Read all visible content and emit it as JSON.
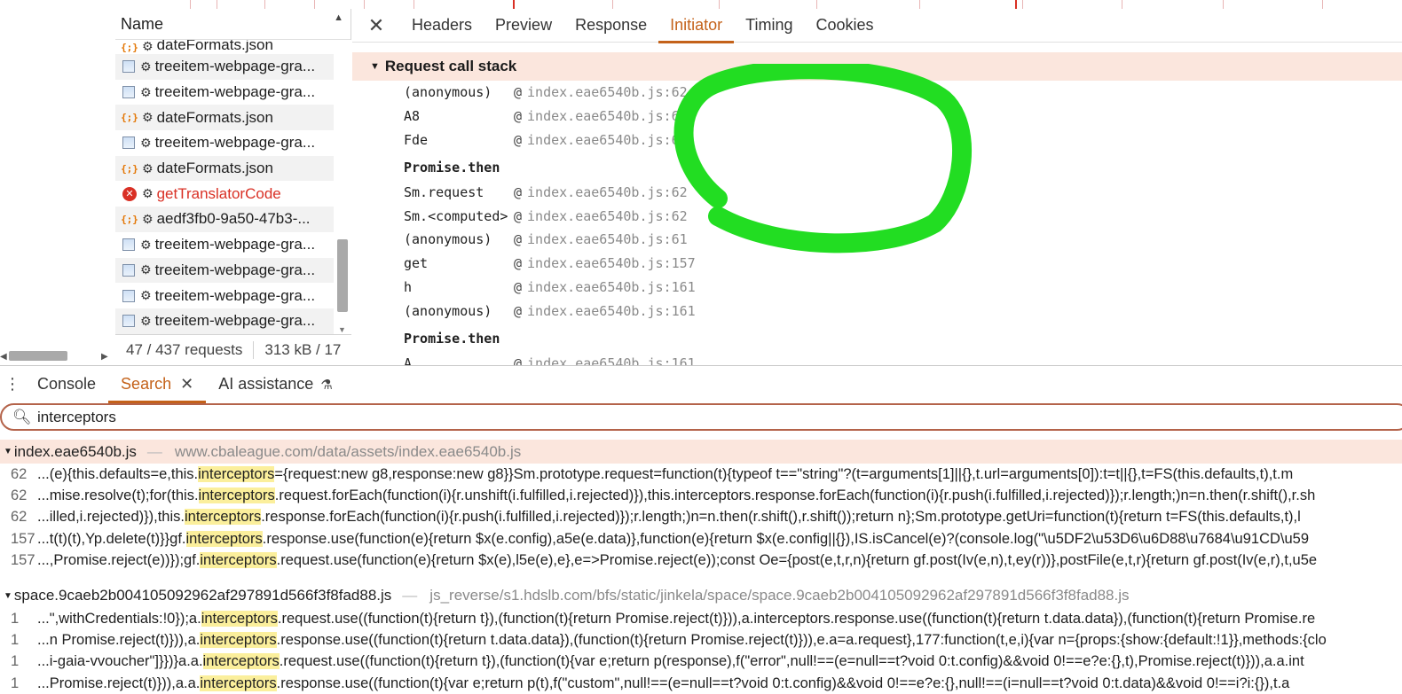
{
  "request_list": {
    "header": "Name",
    "rows": [
      {
        "type": "json",
        "name": "dateFormats.json",
        "error": false
      },
      {
        "type": "image",
        "name": "treeitem-webpage-gra...",
        "error": false
      },
      {
        "type": "image",
        "name": "treeitem-webpage-gra...",
        "error": false
      },
      {
        "type": "json",
        "name": "dateFormats.json",
        "error": false
      },
      {
        "type": "image",
        "name": "treeitem-webpage-gra...",
        "error": false
      },
      {
        "type": "json",
        "name": "dateFormats.json",
        "error": false
      },
      {
        "type": "error",
        "name": "getTranslatorCode",
        "error": true
      },
      {
        "type": "json",
        "name": "aedf3fb0-9a50-47b3-...",
        "error": false
      },
      {
        "type": "image",
        "name": "treeitem-webpage-gra...",
        "error": false
      },
      {
        "type": "image",
        "name": "treeitem-webpage-gra...",
        "error": false
      },
      {
        "type": "image",
        "name": "treeitem-webpage-gra...",
        "error": false
      },
      {
        "type": "image",
        "name": "treeitem-webpage-gra...",
        "error": false
      }
    ],
    "footer": {
      "requests": "47 / 437 requests",
      "size": "313 kB / 17"
    }
  },
  "details": {
    "close": "✕",
    "tabs": [
      "Headers",
      "Preview",
      "Response",
      "Initiator",
      "Timing",
      "Cookies"
    ],
    "active_tab": "Initiator",
    "section_title": "Request call stack",
    "frames": [
      {
        "fn": "(anonymous)",
        "loc": "index.eae6540b.js:62"
      },
      {
        "fn": "A8",
        "loc": "index.eae6540b.js:62"
      },
      {
        "fn": "Fde",
        "loc": "index.eae6540b.js:62"
      },
      {
        "async": "Promise.then"
      },
      {
        "fn": "Sm.request",
        "loc": "index.eae6540b.js:62"
      },
      {
        "fn": "Sm.<computed>",
        "loc": "index.eae6540b.js:62"
      },
      {
        "fn": "(anonymous)",
        "loc": "index.eae6540b.js:61"
      },
      {
        "fn": "get",
        "loc": "index.eae6540b.js:157"
      },
      {
        "fn": "h",
        "loc": "index.eae6540b.js:161"
      },
      {
        "fn": "(anonymous)",
        "loc": "index.eae6540b.js:161"
      },
      {
        "async": "Promise.then"
      },
      {
        "fn": "A",
        "loc": "index.eae6540b.js:161"
      }
    ],
    "at_sign": "@",
    "annotation_color": "#22dd22"
  },
  "drawer": {
    "tabs": [
      {
        "label": "Console",
        "active": false
      },
      {
        "label": "Search",
        "active": true,
        "closable": true
      },
      {
        "label": "AI assistance",
        "active": false,
        "experimental": true
      }
    ],
    "accent": "#c4621a"
  },
  "search": {
    "query": "interceptors",
    "highlight_color": "#fbef9c",
    "files": [
      {
        "name": "index.eae6540b.js",
        "path": "www.cbaleague.com/data/assets/index.eae6540b.js",
        "hits": [
          {
            "line": "62",
            "pre": "...(e){this.defaults=e,this.",
            "post": "={request:new g8,response:new g8}}Sm.prototype.request=function(t){typeof t==\"string\"?(t=arguments[1]||{},t.url=arguments[0]):t=t||{},t=FS(this.defaults,t),t.m"
          },
          {
            "line": "62",
            "pre": "...mise.resolve(t);for(this.",
            "post": ".request.forEach(function(i){r.unshift(i.fulfilled,i.rejected)}),this.interceptors.response.forEach(function(i){r.push(i.fulfilled,i.rejected)});r.length;)n=n.then(r.shift(),r.sh"
          },
          {
            "line": "62",
            "pre": "...illed,i.rejected)}),this.",
            "post": ".response.forEach(function(i){r.push(i.fulfilled,i.rejected)});r.length;)n=n.then(r.shift(),r.shift());return n};Sm.prototype.getUri=function(t){return t=FS(this.defaults,t),l"
          },
          {
            "line": "157",
            "pre": "...t(t)(t),Yp.delete(t)}}gf.",
            "post": ".response.use(function(e){return $x(e.config),a5e(e.data)},function(e){return $x(e.config||{}),IS.isCancel(e)?(console.log(\"\\u5DF2\\u53D6\\u6D88\\u7684\\u91CD\\u59"
          },
          {
            "line": "157",
            "pre": "...,Promise.reject(e))});gf.",
            "post": ".request.use(function(e){return $x(e),l5e(e),e},e=>Promise.reject(e));const Oe={post(e,t,r,n){return gf.post(Iv(e,n),t,ey(r))},postFile(e,t,r){return gf.post(Iv(e,r),t,u5e"
          }
        ]
      },
      {
        "name": "space.9caeb2b004105092962af297891d566f3f8fad88.js",
        "path": "js_reverse/s1.hdslb.com/bfs/static/jinkela/space/space.9caeb2b004105092962af297891d566f3f8fad88.js",
        "hits": [
          {
            "line": "1",
            "pre": "...\",withCredentials:!0});a.",
            "post": ".request.use((function(t){return t}),(function(t){return Promise.reject(t)})),a.interceptors.response.use((function(t){return t.data.data}),(function(t){return Promise.re"
          },
          {
            "line": "1",
            "pre": "...n Promise.reject(t)})),a.",
            "post": ".response.use((function(t){return t.data.data}),(function(t){return Promise.reject(t)})),e.a=a.request},177:function(t,e,i){var n={props:{show:{default:!1}},methods:{clo"
          },
          {
            "line": "1",
            "pre": "...i-gaia-vvoucher\"]}})}a.a.",
            "post": ".request.use((function(t){return t}),(function(t){var e;return p(response),f(\"error\",null!==(e=null==t?void 0:t.config)&&void 0!==e?e:{},t),Promise.reject(t)})),a.a.int"
          },
          {
            "line": "1",
            "pre": "...Promise.reject(t)})),a.a.",
            "post": ".response.use((function(t){var e;return p(t),f(\"custom\",null!==(e=null==t?void 0:t.config)&&void 0!==e?e:{},null!==(i=null==t?void 0:t.data)&&void 0!==i?i:{}),t.a"
          }
        ]
      }
    ]
  }
}
